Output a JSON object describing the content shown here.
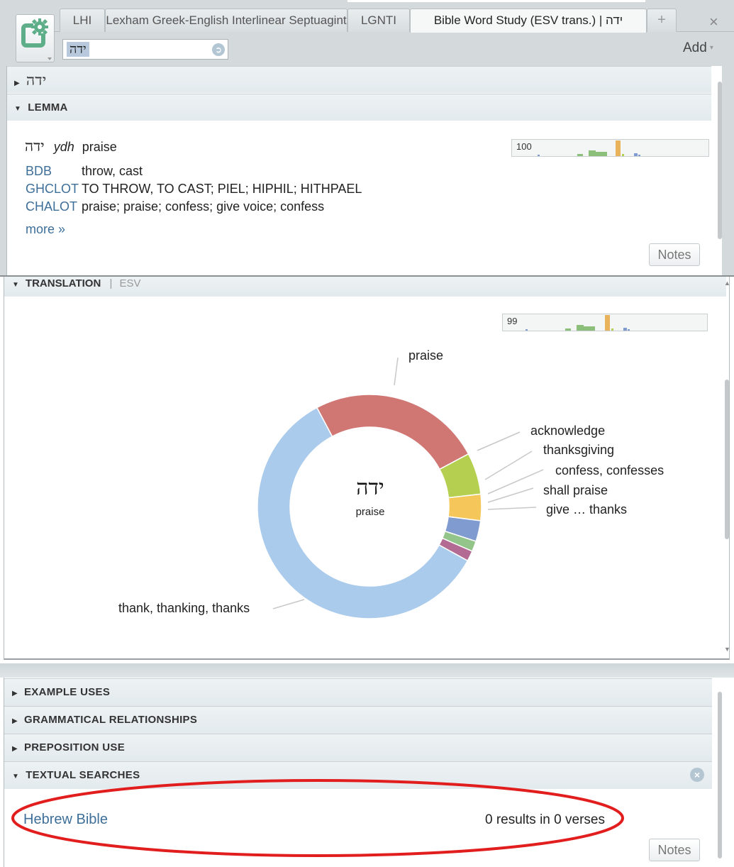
{
  "tabs": [
    {
      "label": "LHI"
    },
    {
      "label": "Lexham Greek-English Interlinear Septuagint"
    },
    {
      "label": "LGNTI"
    },
    {
      "label": "Bible Word Study (ESV trans.) | ידה",
      "active": true
    },
    {
      "label": "+"
    }
  ],
  "close_symbol": "×",
  "search": {
    "value": "ידה",
    "go_symbol": "➲"
  },
  "add_button": {
    "label": "Add",
    "chevron": "▾"
  },
  "top_section": {
    "title": "ידה",
    "collapsed": true
  },
  "lemma": {
    "heading": "LEMMA",
    "word": "ידה",
    "translit": "ydh",
    "gloss": "praise",
    "definitions": [
      {
        "source": "BDB",
        "text": "throw, cast"
      },
      {
        "source": "GHCLOT",
        "text": "TO THROW, TO CAST; PIEL; HIPHIL; HITHPAEL"
      },
      {
        "source": "CHALOT",
        "text": "praise; praise; confess; give voice; confess"
      }
    ],
    "more_link": "more »",
    "graph_value": "100",
    "notes_button": "Notes"
  },
  "translation": {
    "heading": "TRANSLATION",
    "separator": "|",
    "version": "ESV",
    "graph_value": "99",
    "center_word": "ידה",
    "center_gloss": "praise"
  },
  "chart_data": {
    "type": "pie",
    "title": "",
    "center_label": "ידה",
    "center_sublabel": "praise",
    "slices": [
      {
        "label": "praise",
        "value": 25.0,
        "color": "#d07774"
      },
      {
        "label": "acknowledge",
        "value": 6.0,
        "color": "#b5cf50"
      },
      {
        "label": "thanksgiving",
        "value": 3.8,
        "color": "#f5c65a"
      },
      {
        "label": "confess, confesses",
        "value": 3.0,
        "color": "#7f9bd0"
      },
      {
        "label": "shall praise",
        "value": 1.5,
        "color": "#93c48a"
      },
      {
        "label": "give … thanks",
        "value": 1.5,
        "color": "#b36a93"
      },
      {
        "label": "thank, thanking, thanks",
        "value": 59.2,
        "color": "#abcbed"
      }
    ]
  },
  "sections": [
    {
      "title": "EXAMPLE USES",
      "collapsed": true
    },
    {
      "title": "GRAMMATICAL RELATIONSHIPS",
      "collapsed": true
    },
    {
      "title": "PREPOSITION USE",
      "collapsed": true
    },
    {
      "title": "TEXTUAL SEARCHES",
      "collapsed": false
    }
  ],
  "textual_searches": {
    "close_symbol": "×",
    "source": "Hebrew Bible",
    "results": "0 results in 0 verses",
    "notes_button": "Notes"
  },
  "highlight_color": "#e21d1d",
  "accent_link_color": "#3e6f99"
}
